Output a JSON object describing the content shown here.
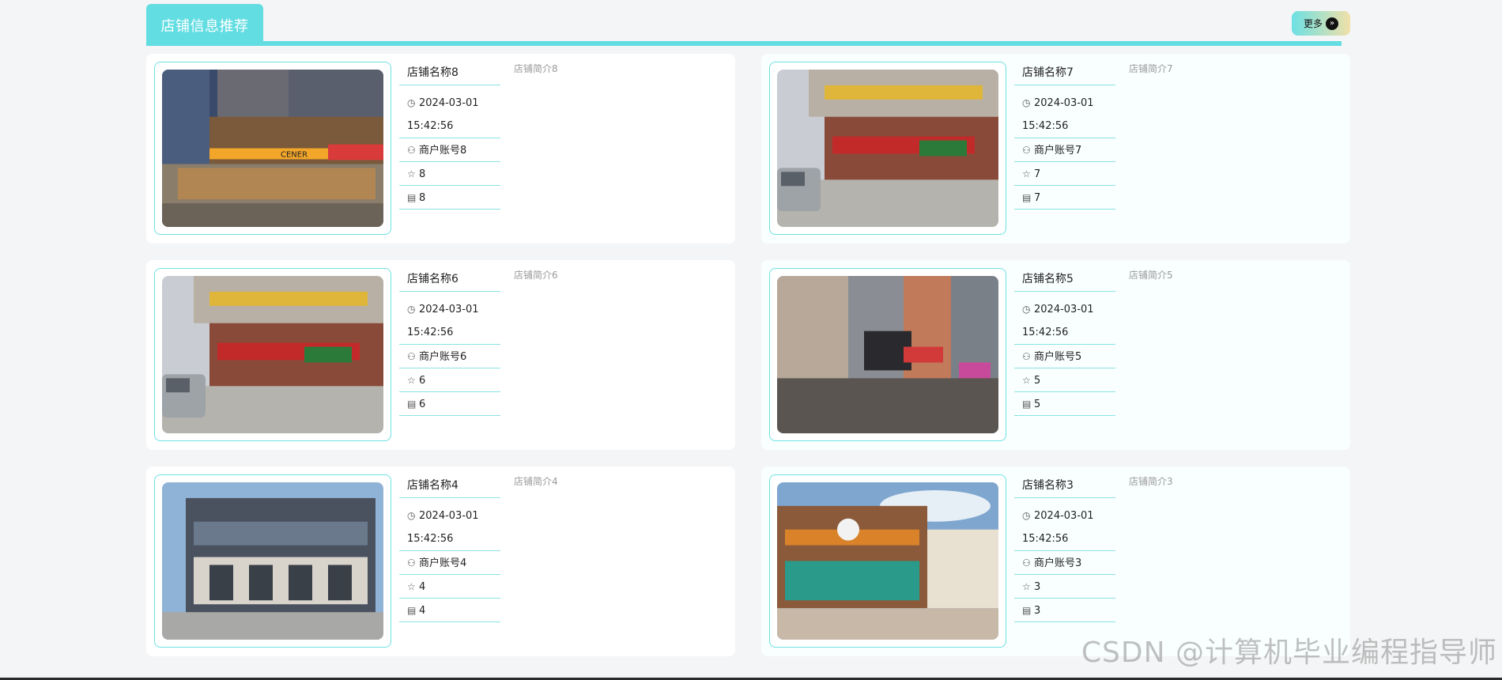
{
  "section": {
    "title": "店铺信息推荐",
    "more_label": "更多"
  },
  "shops": [
    {
      "name": "店铺名称8",
      "date": "2024-03-01",
      "time": "15:42:56",
      "account": "商户账号8",
      "stars": "8",
      "comments": "8",
      "intro": "店铺简介8",
      "image": "night-shopping-street"
    },
    {
      "name": "店铺名称7",
      "date": "2024-03-01",
      "time": "15:42:56",
      "account": "商户账号7",
      "stars": "7",
      "comments": "7",
      "intro": "店铺简介7",
      "image": "street-shops-van"
    },
    {
      "name": "店铺名称6",
      "date": "2024-03-01",
      "time": "15:42:56",
      "account": "商户账号6",
      "stars": "6",
      "comments": "6",
      "intro": "店铺简介6",
      "image": "street-shops-van"
    },
    {
      "name": "店铺名称5",
      "date": "2024-03-01",
      "time": "15:42:56",
      "account": "商户账号5",
      "stars": "5",
      "comments": "5",
      "intro": "店铺简介5",
      "image": "storefront-signs"
    },
    {
      "name": "店铺名称4",
      "date": "2024-03-01",
      "time": "15:42:56",
      "account": "商户账号4",
      "stars": "4",
      "comments": "4",
      "intro": "店铺简介4",
      "image": "modern-building"
    },
    {
      "name": "店铺名称3",
      "date": "2024-03-01",
      "time": "15:42:56",
      "account": "商户账号3",
      "stars": "3",
      "comments": "3",
      "intro": "店铺简介3",
      "image": "food-court-plaza"
    }
  ],
  "watermark": "CSDN @计算机毕业编程指导师",
  "colors": {
    "accent": "#62dde2",
    "divider": "#8be3e3"
  }
}
